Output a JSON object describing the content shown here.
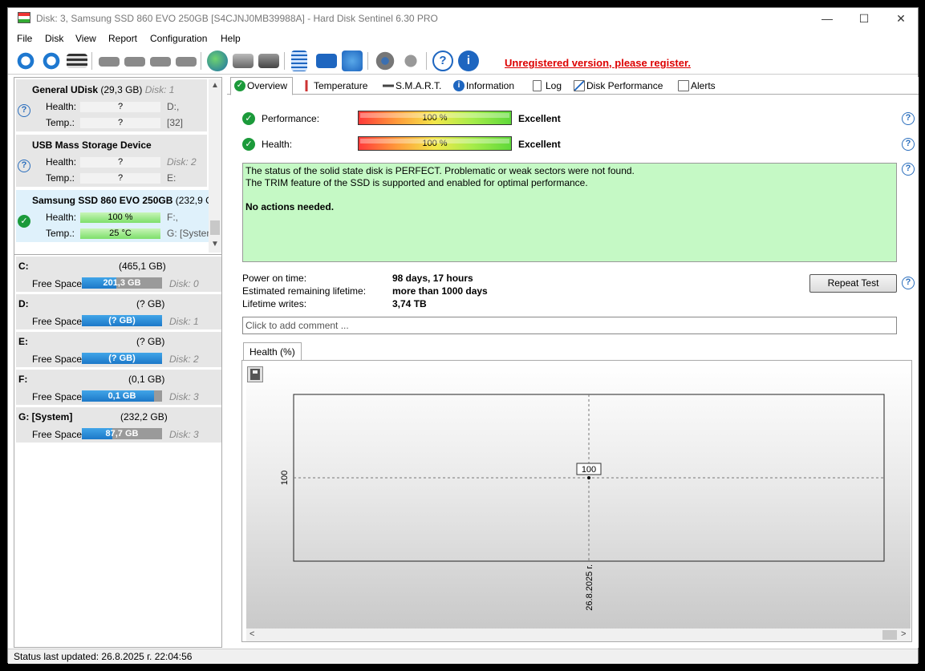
{
  "window": {
    "title": "Disk: 3, Samsung SSD 860 EVO 250GB [S4CJNJ0MB39988A]  -  Hard Disk Sentinel 6.30 PRO",
    "minimize": "—",
    "maximize": "☐",
    "close": "✕"
  },
  "menu": [
    "File",
    "Disk",
    "View",
    "Report",
    "Configuration",
    "Help"
  ],
  "toolbar": {
    "register_link": "Unregistered version, please register.",
    "icons": [
      "refresh-icon",
      "refresh-all-icon",
      "disk-info-icon",
      "disk-gray-icon",
      "disk-clock-icon",
      "disk-check-icon",
      "disk-search-icon",
      "globe-icon",
      "disks-icon",
      "disk-export-icon",
      "report-icon",
      "mail-icon",
      "network-icon",
      "settings-icon",
      "sound-icon",
      "help-icon",
      "info-icon"
    ]
  },
  "disks": [
    {
      "name": "General UDisk",
      "size": "(29,3 GB)",
      "disk": "Disk: 1",
      "health_label": "Health:",
      "health": "?",
      "health_side": "D:,",
      "temp_label": "Temp.:",
      "temp": "?",
      "temp_side": "[32]",
      "status": "unknown"
    },
    {
      "name": "USB Mass Storage Device",
      "size": "",
      "disk": "Disk: 2",
      "health_label": "Health:",
      "health": "?",
      "health_side": "Disk: 2",
      "temp_label": "Temp.:",
      "temp": "?",
      "temp_side": "E:",
      "status": "unknown"
    },
    {
      "name": "Samsung SSD 860 EVO 250GB",
      "size": "(232,9 GB",
      "disk": "",
      "health_label": "Health:",
      "health": "100 %",
      "health_side": "F:,",
      "temp_label": "Temp.:",
      "temp": "25 °C",
      "temp_side": "G: [Systen",
      "status": "ok"
    }
  ],
  "volumes": [
    {
      "name": "C:",
      "size": "(465,1 GB)",
      "free_label": "Free Space",
      "free": "201,3 GB",
      "fill": 0.43,
      "disk": "Disk: 0"
    },
    {
      "name": "D:",
      "size": "(? GB)",
      "free_label": "Free Space",
      "free": "(? GB)",
      "fill": 1.0,
      "disk": "Disk: 1"
    },
    {
      "name": "E:",
      "size": "(? GB)",
      "free_label": "Free Space",
      "free": "(? GB)",
      "fill": 1.0,
      "disk": "Disk: 2"
    },
    {
      "name": "F:",
      "size": "(0,1 GB)",
      "free_label": "Free Space",
      "free": "0,1 GB",
      "fill": 0.9,
      "disk": "Disk: 3"
    },
    {
      "name": "G: [System]",
      "size": "(232,2 GB)",
      "free_label": "Free Space",
      "free": "87,7 GB",
      "fill": 0.38,
      "disk": "Disk: 3"
    }
  ],
  "tabs": [
    "Overview",
    "Temperature",
    "S.M.A.R.T.",
    "Information",
    "Log",
    "Disk Performance",
    "Alerts"
  ],
  "overview": {
    "performance_label": "Performance:",
    "performance_value": "100 %",
    "performance_rating": "Excellent",
    "health_label": "Health:",
    "health_value": "100 %",
    "health_rating": "Excellent",
    "status_line1": "The status of the solid state disk is PERFECT. Problematic or weak sectors were not found.",
    "status_line2": "The TRIM feature of the SSD is supported and enabled for optimal performance.",
    "status_line3": "No actions needed.",
    "power_on_label": "Power on time:",
    "power_on_value": "98 days, 17 hours",
    "lifetime_label": "Estimated remaining lifetime:",
    "lifetime_value": "more than 1000 days",
    "writes_label": "Lifetime writes:",
    "writes_value": "3,74 TB",
    "repeat_test": "Repeat Test",
    "comment_placeholder": "Click to add comment ..."
  },
  "chart_tab": "Health (%)",
  "chart_data": {
    "type": "line",
    "title": "",
    "x": [
      "26.8.2025 г."
    ],
    "series": [
      {
        "values": [
          100
        ]
      }
    ],
    "point_labels": [
      "100"
    ],
    "y_tick_labels": [
      "100"
    ],
    "x_tick_labels": [
      "26.8.2025 г."
    ],
    "grid": true
  },
  "statusbar": {
    "text": "Status last updated: 26.8.2025 г. 22:04:56"
  }
}
